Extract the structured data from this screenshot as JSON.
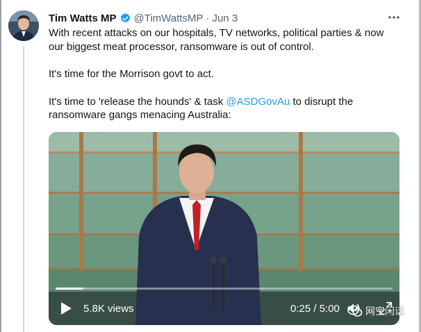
{
  "tweet": {
    "author_name": "Tim Watts MP",
    "handle": "@TimWattsMP",
    "separator": "·",
    "date": "Jun 3",
    "paragraph1": "With recent attacks on our hospitals, TV networks, political parties & now our biggest meat processor, ransomware is out of control.",
    "paragraph2": "It's time for the Morrison govt to act.",
    "paragraph3_before": "It's time to 'release the hounds' & task ",
    "paragraph3_mention": "@ASDGovAu",
    "paragraph3_after": " to disrupt the ransomware gangs menacing Australia:"
  },
  "video": {
    "views": "5.8K views",
    "time": "0:25 / 5:00",
    "progress_fraction": 0.083
  },
  "watermark": {
    "text": "网空闲话"
  },
  "icons": {
    "verified": "verified-badge-icon",
    "more": "more-icon",
    "play": "play-icon",
    "volume": "volume-icon",
    "expand": "expand-icon"
  },
  "colors": {
    "accent": "#1d9bf0",
    "text": "#0f1419",
    "muted": "#536471"
  }
}
